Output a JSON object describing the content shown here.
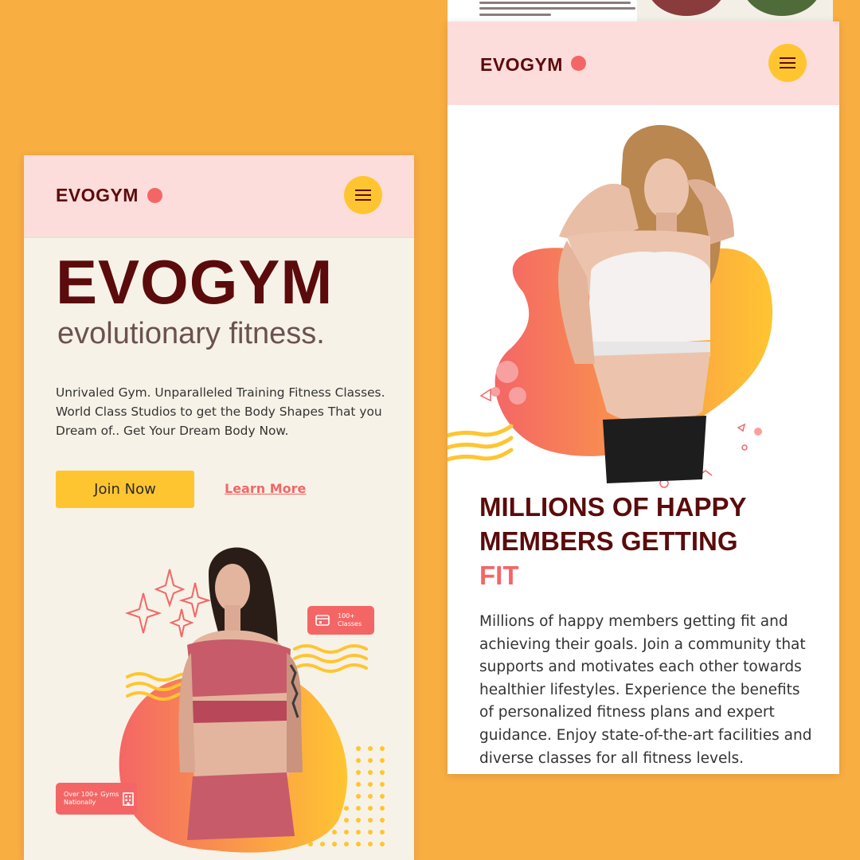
{
  "left_screen": {
    "nav": {
      "logo": "EVOGYM",
      "menu_icon": "hamburger-icon"
    },
    "hero": {
      "title": "EVOGYM",
      "subtitle": "evolutionary fitness.",
      "description": "Unrivaled Gym. Unparalleled Training Fitness Classes. World Class Studios to get the Body Shapes That you Dream of.. Get Your Dream Body Now.",
      "primary_button": "Join Now",
      "secondary_link": "Learn More"
    },
    "badges": [
      {
        "text": "100+ Classes",
        "icon": "ticket-icon"
      },
      {
        "text": "Over 100+ Gyms Nationally",
        "icon": "building-icon"
      }
    ]
  },
  "right_screen": {
    "nav": {
      "logo": "EVOGYM",
      "menu_icon": "hamburger-icon"
    },
    "section": {
      "title_lines": [
        "MILLIONS OF HAPPY",
        "MEMBERS GETTING"
      ],
      "title_accent": "FIT",
      "description": "Millions of happy members getting fit and achieving their goals. Join a community that supports and motivates each other towards healthier lifestyles. Experience the benefits of personalized fitness plans and expert guidance. Enjoy state-of-the-art facilities and diverse classes for all fitness levels."
    }
  },
  "colors": {
    "page_background": "#F9AE42",
    "navbar": "#FDDDDB",
    "brand_dark": "#5B0B0B",
    "accent_coral": "#F46666",
    "accent_yellow": "#FFC531",
    "screen_background": "#F7F2E7"
  }
}
